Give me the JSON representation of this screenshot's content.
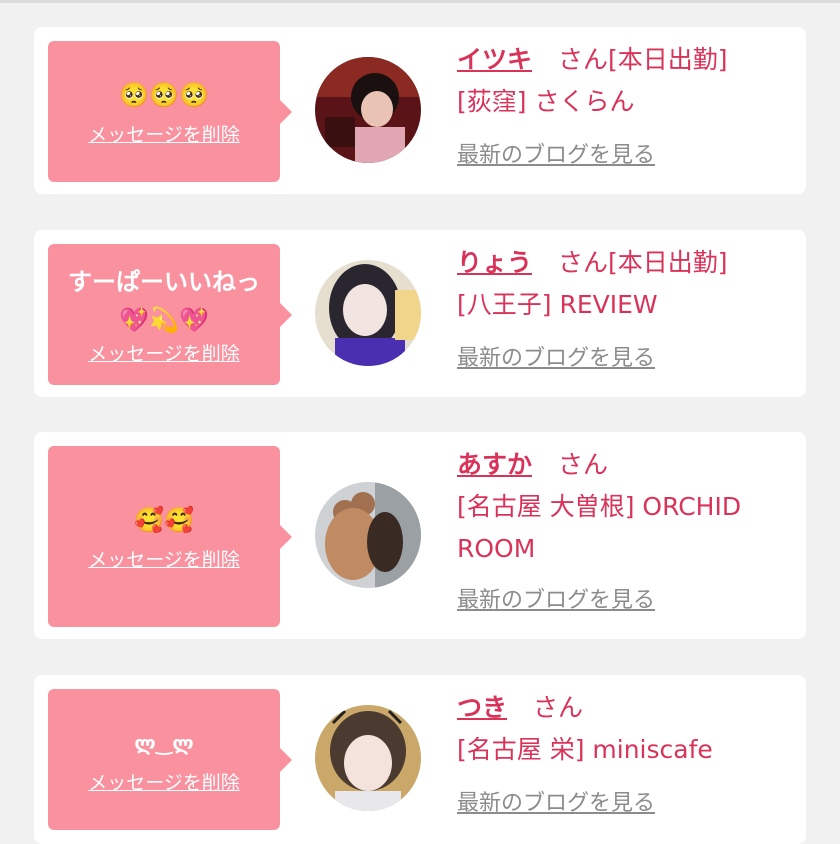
{
  "messages": [
    {
      "text": "🥺🥺🥺",
      "delete_label": "メッセージを削除",
      "name": "イツキ",
      "honorific": "さん[本日出勤]",
      "shop": "[荻窪] さくらん",
      "blog_label": "最新のブログを見る"
    },
    {
      "text": "すーぱーいいねっ💖💫💖",
      "delete_label": "メッセージを削除",
      "name": "りょう",
      "honorific": "さん[本日出勤]",
      "shop": "[八王子] REVIEW",
      "blog_label": "最新のブログを見る"
    },
    {
      "text": "🥰🥰",
      "delete_label": "メッセージを削除",
      "name": "あすか",
      "honorific": "さん",
      "shop": "[名古屋 大曽根] ORCHID ROOM",
      "blog_label": "最新のブログを見る"
    },
    {
      "text": "ლ‿ლ",
      "delete_label": "メッセージを削除",
      "name": "つき",
      "honorific": "さん",
      "shop": "[名古屋 栄] miniscafe",
      "blog_label": "最新のブログを見る"
    }
  ],
  "colors": {
    "bubble": "#f9919f",
    "accent": "#d9335a",
    "link_gray": "#8c8c8c",
    "background": "#f1f1f1"
  }
}
